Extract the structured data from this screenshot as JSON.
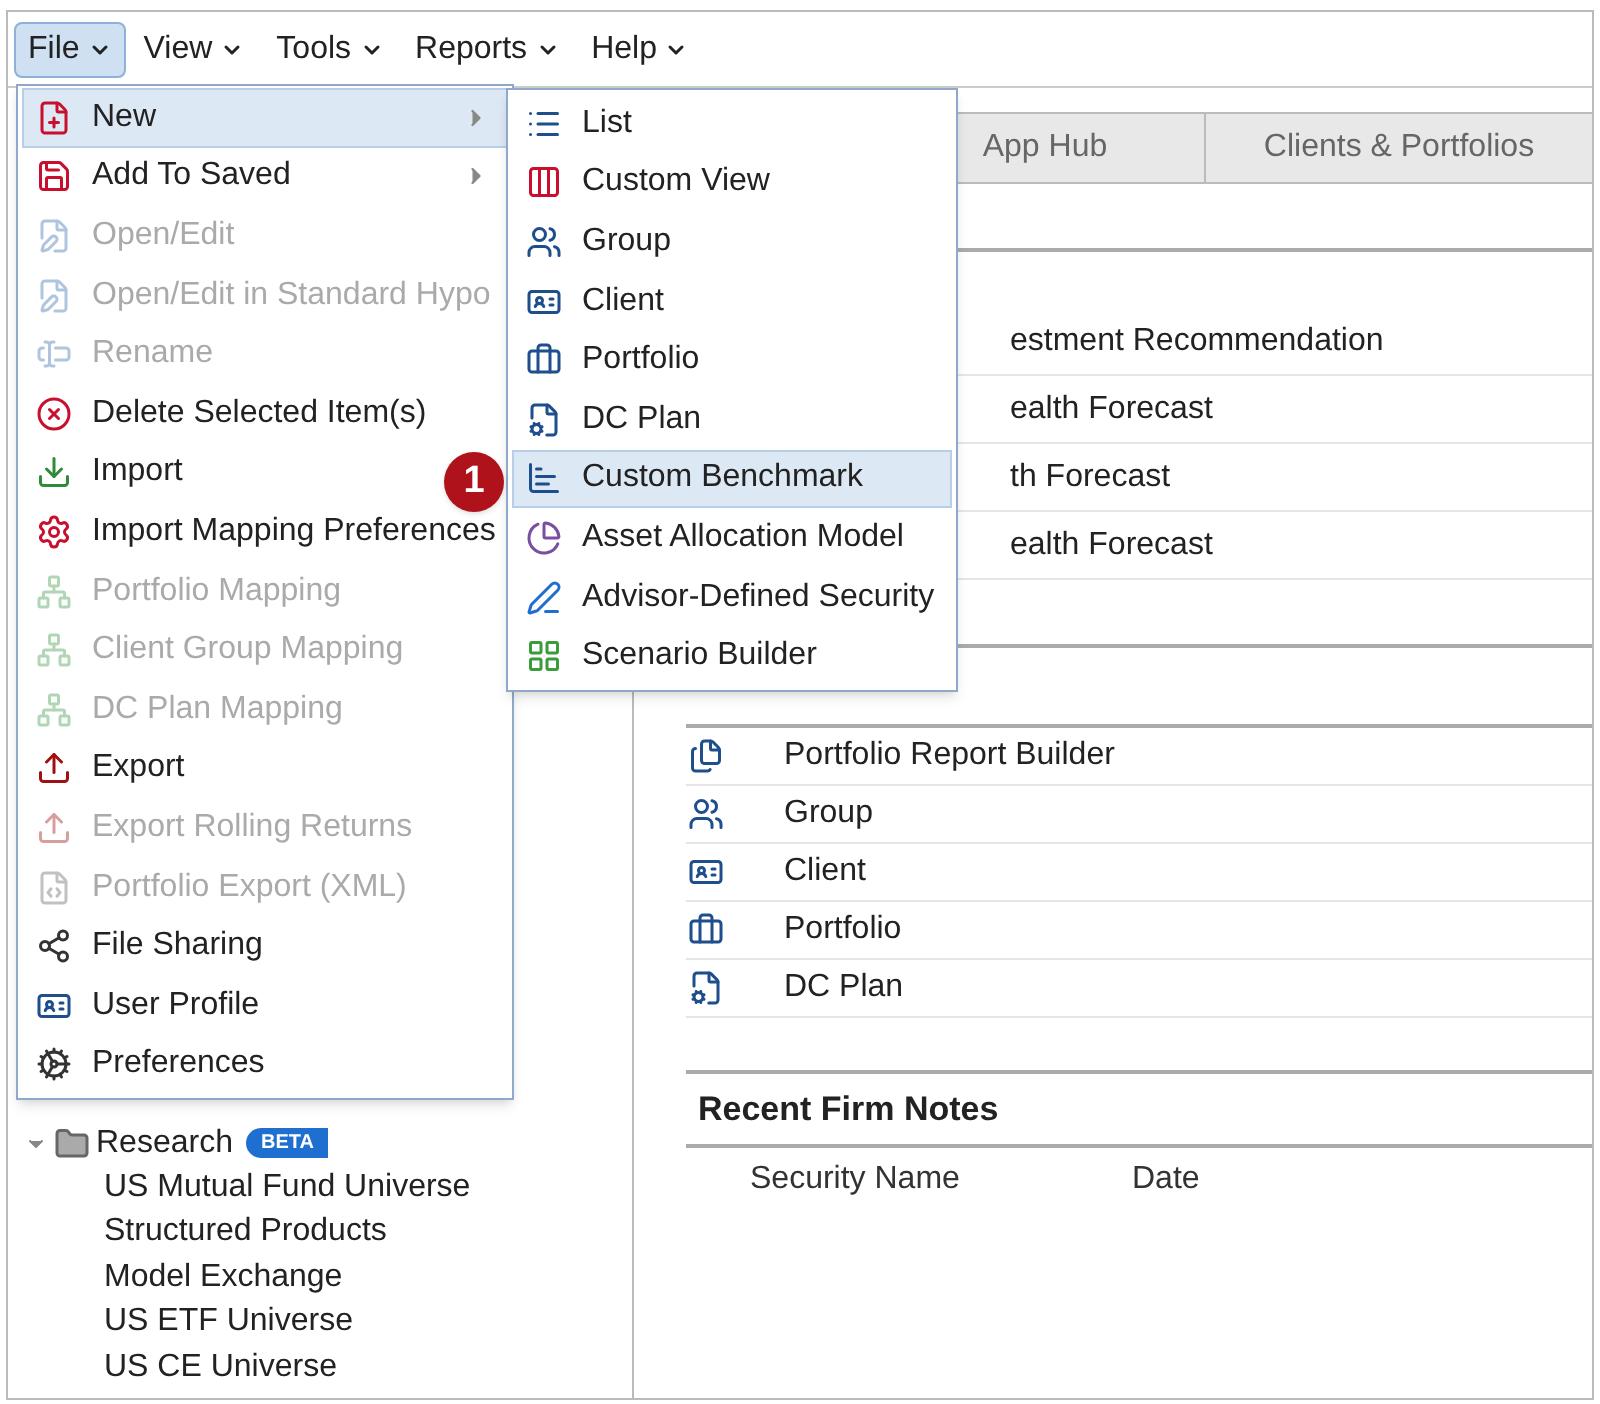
{
  "menu_bar": [
    {
      "label": "File",
      "selected": true
    },
    {
      "label": "View",
      "selected": false
    },
    {
      "label": "Tools",
      "selected": false
    },
    {
      "label": "Reports",
      "selected": false
    },
    {
      "label": "Help",
      "selected": false
    }
  ],
  "file_menu": [
    {
      "label": "New",
      "disabled": false,
      "selected": true,
      "submenu": true
    },
    {
      "label": "Add To Saved",
      "disabled": false,
      "selected": false,
      "submenu": true
    },
    {
      "label": "Open/Edit",
      "disabled": true,
      "selected": false,
      "submenu": false
    },
    {
      "label": "Open/Edit in Standard Hypo",
      "disabled": true,
      "selected": false,
      "submenu": false
    },
    {
      "label": "Rename",
      "disabled": true,
      "selected": false,
      "submenu": false
    },
    {
      "label": "Delete Selected Item(s)",
      "disabled": false,
      "selected": false,
      "submenu": false
    },
    {
      "label": "Import",
      "disabled": false,
      "selected": false,
      "submenu": false
    },
    {
      "label": "Import Mapping Preferences",
      "disabled": false,
      "selected": false,
      "submenu": false
    },
    {
      "label": "Portfolio Mapping",
      "disabled": true,
      "selected": false,
      "submenu": false
    },
    {
      "label": "Client Group Mapping",
      "disabled": true,
      "selected": false,
      "submenu": false
    },
    {
      "label": "DC Plan Mapping",
      "disabled": true,
      "selected": false,
      "submenu": false
    },
    {
      "label": "Export",
      "disabled": false,
      "selected": false,
      "submenu": false
    },
    {
      "label": "Export Rolling Returns",
      "disabled": true,
      "selected": false,
      "submenu": false
    },
    {
      "label": "Portfolio Export (XML)",
      "disabled": true,
      "selected": false,
      "submenu": false
    },
    {
      "label": "File Sharing",
      "disabled": false,
      "selected": false,
      "submenu": false
    },
    {
      "label": "User Profile",
      "disabled": false,
      "selected": false,
      "submenu": false
    },
    {
      "label": "Preferences",
      "disabled": false,
      "selected": false,
      "submenu": false
    }
  ],
  "new_submenu": [
    {
      "label": "List",
      "selected": false
    },
    {
      "label": "Custom View",
      "selected": false
    },
    {
      "label": "Group",
      "selected": false
    },
    {
      "label": "Client",
      "selected": false
    },
    {
      "label": "Portfolio",
      "selected": false
    },
    {
      "label": "DC Plan",
      "selected": false
    },
    {
      "label": "Custom Benchmark",
      "selected": true
    },
    {
      "label": "Asset Allocation Model",
      "selected": false
    },
    {
      "label": "Advisor-Defined Security",
      "selected": false
    },
    {
      "label": "Scenario Builder",
      "selected": false
    }
  ],
  "callout": "1",
  "tabs": [
    {
      "label": "App Hub",
      "selected": false
    },
    {
      "label": "Clients & Portfolios",
      "selected": false
    }
  ],
  "recent_rows": [
    "estment Recommendation",
    "ealth Forecast",
    "th Forecast",
    "ealth Forecast"
  ],
  "quick_start": {
    "items": [
      "Portfolio Report Builder",
      "Group",
      "Client",
      "Portfolio",
      "DC Plan"
    ]
  },
  "recent_firm_notes": {
    "title": "Recent Firm Notes",
    "columns": [
      "Security Name",
      "Date"
    ]
  },
  "tree": [
    {
      "label": "Research",
      "badge": "BETA",
      "expanded": true,
      "children": [
        {
          "label": "US Mutual Fund Universe"
        },
        {
          "label": "Structured Products"
        },
        {
          "label": "Model Exchange"
        },
        {
          "label": "US ETF Universe"
        },
        {
          "label": "US CE Universe"
        }
      ]
    }
  ]
}
